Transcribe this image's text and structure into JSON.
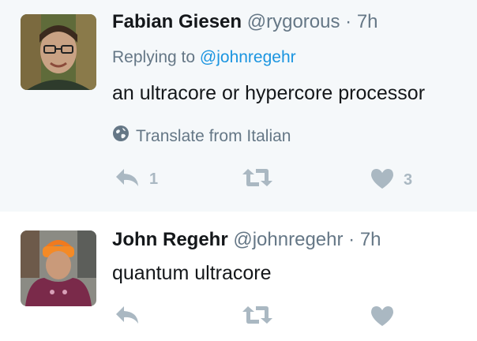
{
  "tweets": [
    {
      "name": "Fabian Giesen",
      "handle": "@rygorous",
      "separator": "·",
      "time": "7h",
      "replying_prefix": "Replying to",
      "replying_to": "@johnregehr",
      "text": "an ultracore or hypercore processor",
      "translate_label": "Translate from Italian",
      "translate_icon": "globe-icon",
      "actions": {
        "reply_count": "1",
        "retweet_count": "",
        "like_count": "3"
      }
    },
    {
      "name": "John Regehr",
      "handle": "@johnregehr",
      "separator": "·",
      "time": "7h",
      "text": "quantum ultracore",
      "actions": {
        "reply_count": "",
        "retweet_count": "",
        "like_count": ""
      }
    }
  ],
  "colors": {
    "link": "#1b95e0",
    "muted": "#657786",
    "icon": "#aab8c2",
    "thread_line": "#6ab8d6",
    "highlight_bg": "#f5f8fa"
  }
}
